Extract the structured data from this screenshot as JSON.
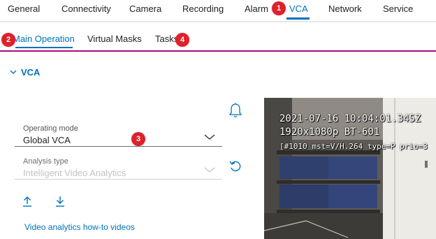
{
  "top_nav": {
    "tabs": [
      {
        "label": "General"
      },
      {
        "label": "Connectivity"
      },
      {
        "label": "Camera"
      },
      {
        "label": "Recording"
      },
      {
        "label": "Alarm"
      },
      {
        "label": "VCA"
      },
      {
        "label": "Network"
      },
      {
        "label": "Service"
      }
    ],
    "active": "VCA"
  },
  "sub_nav": {
    "tabs": [
      {
        "label": "Main Operation"
      },
      {
        "label": "Virtual Masks"
      },
      {
        "label": "Tasks"
      }
    ],
    "active": "Main Operation"
  },
  "section": {
    "title": "VCA"
  },
  "form": {
    "operating_mode": {
      "label": "Operating mode",
      "value": "Global VCA"
    },
    "analysis_type": {
      "label": "Analysis type",
      "value": "Intelligent Video Analytics",
      "disabled": true
    }
  },
  "help_link": "Video analytics how-to videos",
  "video_osd": {
    "line1": "2021-07-16 10:04:01.345Z",
    "line2": "1920x1080p BT-601",
    "line3": "[#1010 mst=V/H.264 type=P prio=3"
  },
  "badges": [
    "1",
    "2",
    "3",
    "4"
  ],
  "icons": {
    "alarm": "bell-icon",
    "reset": "undo-icon",
    "upload": "upload-icon",
    "download": "download-icon",
    "section_toggle": "chevron-down-icon",
    "dropdown": "chevron-down-icon"
  },
  "colors": {
    "accent": "#0071b9",
    "brand_rule": "#b10a7a",
    "badge": "#e0202a"
  }
}
